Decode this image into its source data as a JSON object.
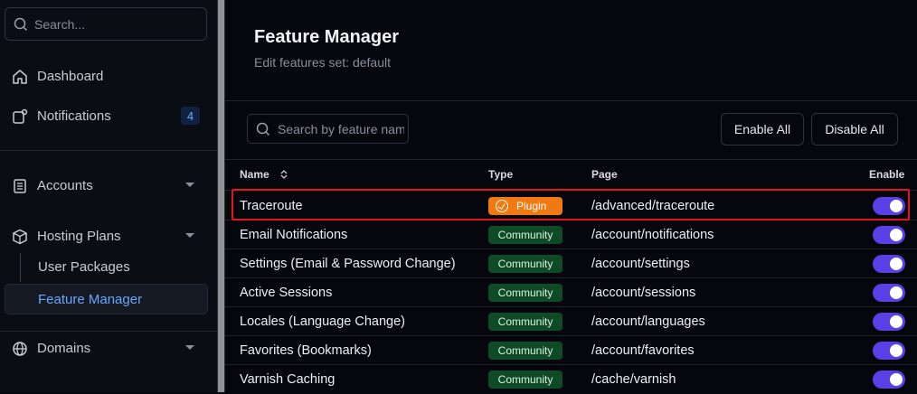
{
  "sidebar": {
    "search_placeholder": "Search...",
    "items": [
      {
        "label": "Dashboard"
      },
      {
        "label": "Notifications",
        "badge": "4"
      },
      {
        "label": "Accounts"
      },
      {
        "label": "Hosting Plans"
      },
      {
        "label": "Domains"
      }
    ],
    "sub_items": [
      {
        "label": "User Packages"
      },
      {
        "label": "Feature Manager"
      }
    ]
  },
  "header": {
    "title": "Feature Manager",
    "subtitle": "Edit features set: default"
  },
  "toolbar": {
    "search_placeholder": "Search by feature name",
    "enable_all_label": "Enable All",
    "disable_all_label": "Disable All"
  },
  "table": {
    "columns": {
      "name": "Name",
      "type": "Type",
      "page": "Page",
      "enable": "Enable"
    },
    "rows": [
      {
        "name": "Traceroute",
        "type": "Plugin",
        "page": "/advanced/traceroute",
        "enabled": true
      },
      {
        "name": "Email Notifications",
        "type": "Community",
        "page": "/account/notifications",
        "enabled": true
      },
      {
        "name": "Settings (Email & Password Change)",
        "type": "Community",
        "page": "/account/settings",
        "enabled": true
      },
      {
        "name": "Active Sessions",
        "type": "Community",
        "page": "/account/sessions",
        "enabled": true
      },
      {
        "name": "Locales (Language Change)",
        "type": "Community",
        "page": "/account/languages",
        "enabled": true
      },
      {
        "name": "Favorites (Bookmarks)",
        "type": "Community",
        "page": "/account/favorites",
        "enabled": true
      },
      {
        "name": "Varnish Caching",
        "type": "Community",
        "page": "/cache/varnish",
        "enabled": true
      }
    ]
  },
  "colors": {
    "accent": "#5b3fe6",
    "plugin": "#f07a11",
    "community": "#0f4a26",
    "highlight": "#e4161c",
    "active_link": "#6aa7ff"
  }
}
